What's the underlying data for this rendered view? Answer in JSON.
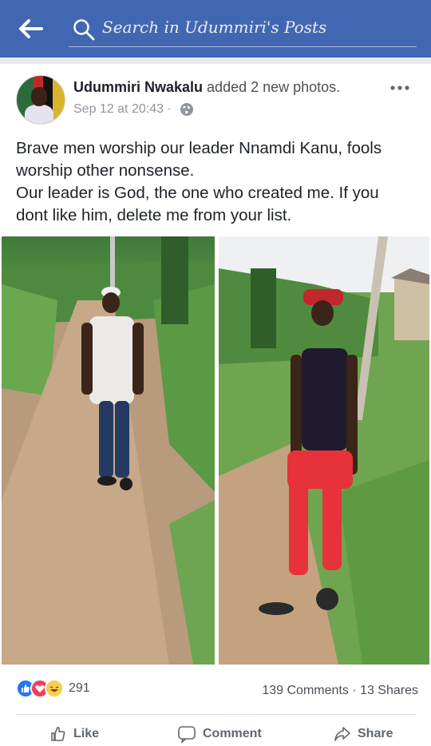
{
  "header": {
    "back_icon": "back-arrow-icon",
    "search_icon": "search-icon",
    "search_placeholder": "Search in Udummiri's Posts",
    "bg_color": "#4267b2"
  },
  "post": {
    "author": "Udummiri Nwakalu",
    "action_text": " added 2 new photos.",
    "timestamp": "Sep 12 at 20:43",
    "meta_separator": " · ",
    "privacy_icon": "globe-icon",
    "more_icon": "more-options-icon",
    "text_lines": [
      "Brave men worship our leader Nnamdi Kanu,  fools",
      "worship other nonsense.",
      "Our leader is God, the one who created me. If you",
      "dont like him,  delete me from your list."
    ],
    "photos": [
      {
        "icon": "photo-man-white-shirt"
      },
      {
        "icon": "photo-man-red-pants"
      }
    ]
  },
  "stats": {
    "reactions": [
      "like",
      "love",
      "haha"
    ],
    "reaction_count": "291",
    "comments": "139 Comments",
    "shares": "13 Shares",
    "separator": " · "
  },
  "actions": {
    "like": "Like",
    "comment": "Comment",
    "share": "Share"
  },
  "colors": {
    "accent": "#4267b2",
    "like": "#2078f4",
    "love": "#f33e58",
    "haha": "#fbcd4d",
    "text": "#1d2129",
    "muted": "#90949c"
  }
}
